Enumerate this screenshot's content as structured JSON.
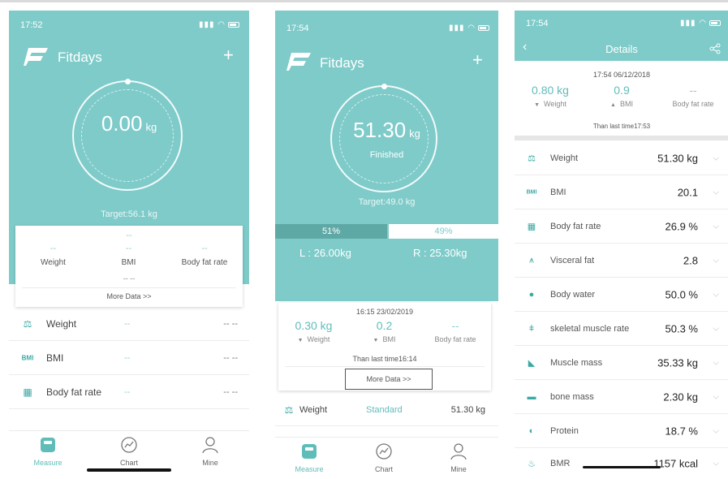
{
  "colors": {
    "teal": "#7ecbc9",
    "teal_dark": "#5ea9a6",
    "accent_text": "#5fbdb9"
  },
  "screen1": {
    "time": "17:52",
    "app_name": "Fitdays",
    "weight_value": "0.00",
    "weight_unit": "kg",
    "target": "Target:56.1 kg",
    "card": {
      "top_dash": "--",
      "metrics": [
        {
          "value": "--",
          "label": "Weight"
        },
        {
          "value": "--",
          "label": "BMI"
        },
        {
          "value": "--",
          "label": "Body fat rate"
        }
      ],
      "bottom_dash": "-- --",
      "more": "More Data >>"
    },
    "rows": [
      {
        "icon": "scale-icon",
        "label": "Weight",
        "mid": "--",
        "right": "-- --"
      },
      {
        "icon": "bmi-icon",
        "icon_text": "BMI",
        "label": "BMI",
        "mid": "--",
        "right": "-- --"
      },
      {
        "icon": "grid-icon",
        "label": "Body fat rate",
        "mid": "--",
        "right": "-- --"
      }
    ],
    "nav": [
      {
        "label": "Measure",
        "icon": "scale-icon",
        "active": true
      },
      {
        "label": "Chart",
        "icon": "chart-icon",
        "active": false
      },
      {
        "label": "Mine",
        "icon": "user-icon",
        "active": false
      }
    ]
  },
  "screen2": {
    "time": "17:54",
    "app_name": "Fitdays",
    "weight_value": "51.30",
    "weight_unit": "kg",
    "status": "Finished",
    "target": "Target:49.0 kg",
    "split": {
      "left_percent": 51,
      "left_label": "51%",
      "right_label": "49%",
      "left_value": "L : 26.00kg",
      "right_value": "R : 25.30kg"
    },
    "card": {
      "timestamp": "16:15 23/02/2019",
      "metrics": [
        {
          "value": "0.30 kg",
          "trend": "▼",
          "label": "Weight"
        },
        {
          "value": "0.2",
          "trend": "▼",
          "label": "BMI"
        },
        {
          "value": "--",
          "trend": "",
          "label": "Body fat rate"
        }
      ],
      "compare": "Than last time16:14",
      "more": "More Data >>"
    },
    "row": {
      "label": "Weight",
      "mid": "Standard",
      "right": "51.30 kg"
    },
    "nav": [
      {
        "label": "Measure"
      },
      {
        "label": "Chart"
      },
      {
        "label": "Mine"
      }
    ]
  },
  "screen3": {
    "time": "17:54",
    "title": "Details",
    "timestamp": "17:54 06/12/2018",
    "metrics": [
      {
        "value": "0.80 kg",
        "trend": "▼",
        "label": "Weight"
      },
      {
        "value": "0.9",
        "trend": "▲",
        "label": "BMI"
      },
      {
        "value": "--",
        "trend": "",
        "label": "Body fat rate"
      }
    ],
    "compare": "Than last time17:53",
    "rows": [
      {
        "icon": "scale-icon",
        "label": "Weight",
        "value": "51.30 kg"
      },
      {
        "icon": "bmi-icon",
        "icon_text": "BMI",
        "label": "BMI",
        "value": "20.1"
      },
      {
        "icon": "grid-icon",
        "label": "Body fat rate",
        "value": "26.9 %"
      },
      {
        "icon": "visceral-icon",
        "label": "Visceral fat",
        "value": "2.8"
      },
      {
        "icon": "water-drop-icon",
        "label": "Body water",
        "value": "50.0 %"
      },
      {
        "icon": "skeleton-icon",
        "label": "skeletal muscle rate",
        "value": "50.3 %"
      },
      {
        "icon": "muscle-icon",
        "label": "Muscle mass",
        "value": "35.33 kg"
      },
      {
        "icon": "bone-icon",
        "label": "bone mass",
        "value": "2.30 kg"
      },
      {
        "icon": "protein-icon",
        "label": "Protein",
        "value": "18.7 %"
      },
      {
        "icon": "flame-icon",
        "label": "BMR",
        "value": "1157 kcal"
      }
    ]
  }
}
